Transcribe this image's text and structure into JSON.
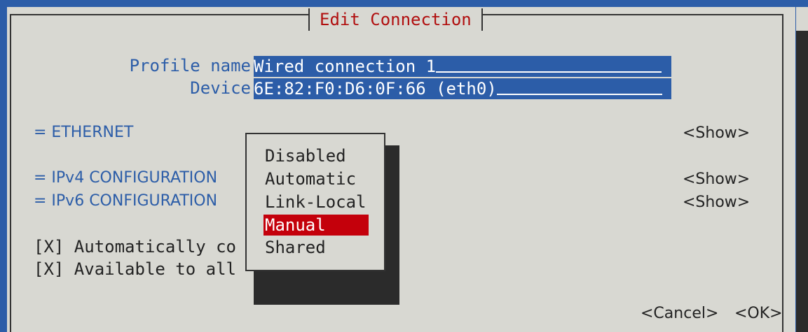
{
  "dialog": {
    "title": "Edit Connection"
  },
  "profile": {
    "name_label": "Profile name",
    "name_value": "Wired connection 1",
    "device_label": "Device",
    "device_value": "6E:82:F0:D6:0F:66 (eth0)"
  },
  "sections": {
    "ethernet": "= ETHERNET",
    "ipv4": "= IPv4 CONFIGURATION",
    "ipv6": "= IPv6 CONFIGURATION",
    "show_label": "<Show>"
  },
  "checkboxes": {
    "auto_connect": "[X] Automatically co",
    "available_all": "[X] Available to all"
  },
  "dropdown": {
    "options": [
      "Disabled",
      "Automatic",
      "Link-Local",
      "Manual",
      "Shared"
    ],
    "selected": "Manual"
  },
  "footer": {
    "cancel": "<Cancel>",
    "ok": "<OK>"
  }
}
